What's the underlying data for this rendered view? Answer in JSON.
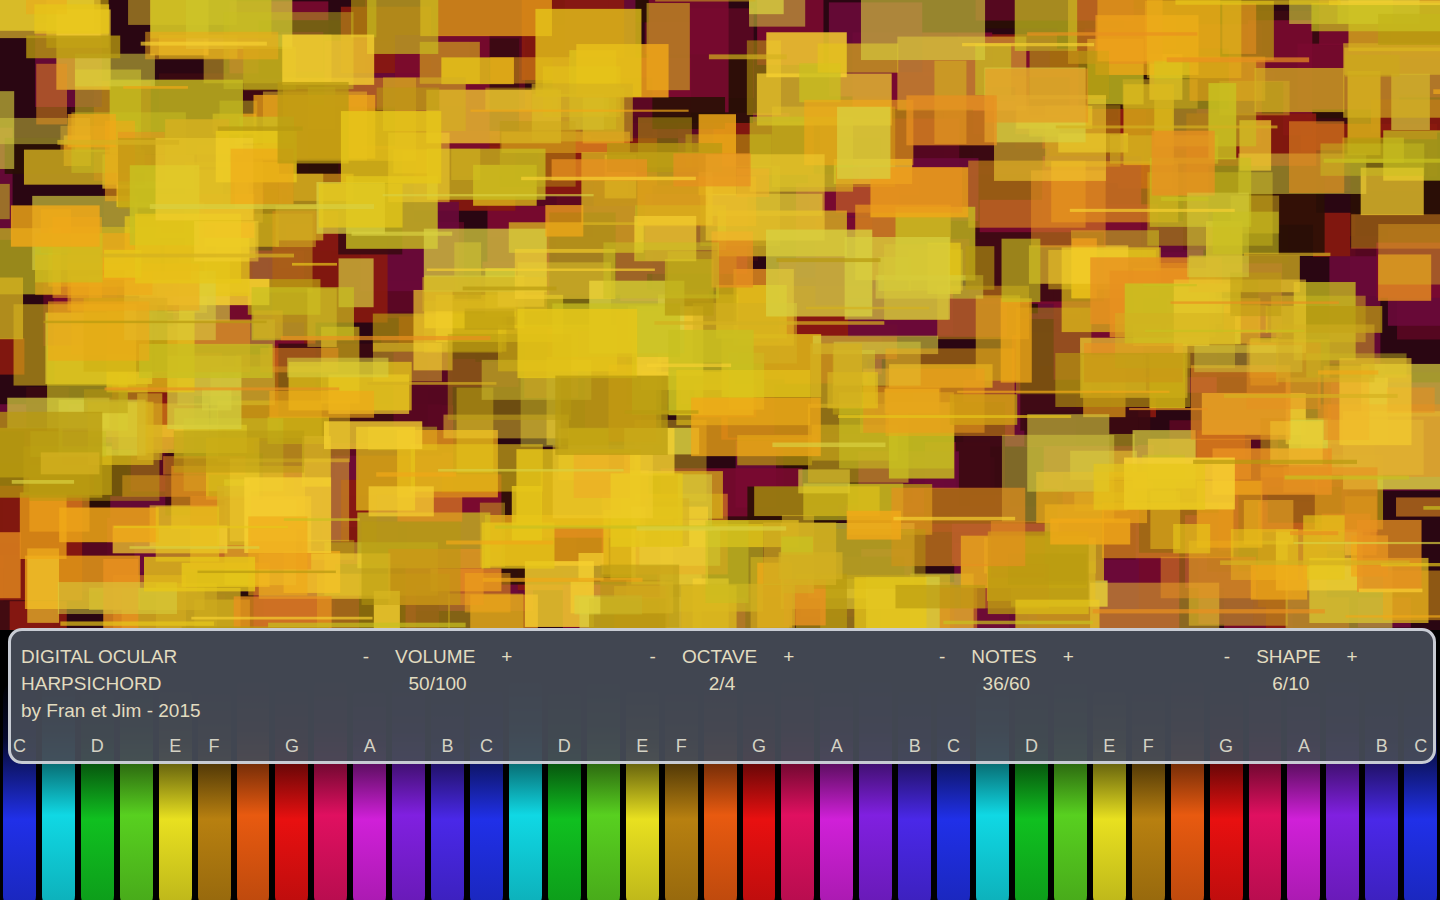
{
  "app": {
    "title_lines": [
      "DIGITAL OCULAR",
      "HARPSICHORD"
    ],
    "credit": "by Fran et Jim - 2015"
  },
  "controls": [
    {
      "label": "VOLUME",
      "value": "50/100",
      "minus": "-",
      "plus": "+"
    },
    {
      "label": "OCTAVE",
      "value": "2/4",
      "minus": "-",
      "plus": "+"
    },
    {
      "label": "NOTES",
      "value": "36/60",
      "minus": "-",
      "plus": "+"
    },
    {
      "label": "SHAPE",
      "value": "6/10",
      "minus": "-",
      "plus": "+"
    }
  ],
  "keys": [
    {
      "kind": "natural",
      "label": "C",
      "color": "#2030e8"
    },
    {
      "kind": "sharp",
      "color": "#10d8e4"
    },
    {
      "kind": "natural",
      "label": "D",
      "color": "#10c020"
    },
    {
      "kind": "sharp",
      "color": "#58d020"
    },
    {
      "kind": "natural",
      "label": "E",
      "color": "#e8e020"
    },
    {
      "kind": "natural",
      "label": "F",
      "color": "#b88010"
    },
    {
      "kind": "sharp",
      "color": "#e85a10"
    },
    {
      "kind": "natural",
      "label": "G",
      "color": "#e81010"
    },
    {
      "kind": "sharp",
      "color": "#e01060"
    },
    {
      "kind": "natural",
      "label": "A",
      "color": "#d020d8"
    },
    {
      "kind": "sharp",
      "color": "#8020e0"
    },
    {
      "kind": "natural",
      "label": "B",
      "color": "#4a28e8"
    },
    {
      "kind": "natural",
      "label": "C",
      "color": "#2030e8"
    },
    {
      "kind": "sharp",
      "color": "#10d8e4"
    },
    {
      "kind": "natural",
      "label": "D",
      "color": "#10c020"
    },
    {
      "kind": "sharp",
      "color": "#58d020"
    },
    {
      "kind": "natural",
      "label": "E",
      "color": "#e8e020"
    },
    {
      "kind": "natural",
      "label": "F",
      "color": "#b88010"
    },
    {
      "kind": "sharp",
      "color": "#e85a10"
    },
    {
      "kind": "natural",
      "label": "G",
      "color": "#e81010"
    },
    {
      "kind": "sharp",
      "color": "#e01060"
    },
    {
      "kind": "natural",
      "label": "A",
      "color": "#d020d8"
    },
    {
      "kind": "sharp",
      "color": "#8020e0"
    },
    {
      "kind": "natural",
      "label": "B",
      "color": "#4a28e8"
    },
    {
      "kind": "natural",
      "label": "C",
      "color": "#2030e8"
    },
    {
      "kind": "sharp",
      "color": "#10d8e4"
    },
    {
      "kind": "natural",
      "label": "D",
      "color": "#10c020"
    },
    {
      "kind": "sharp",
      "color": "#58d020"
    },
    {
      "kind": "natural",
      "label": "E",
      "color": "#e8e020"
    },
    {
      "kind": "natural",
      "label": "F",
      "color": "#b88010"
    },
    {
      "kind": "sharp",
      "color": "#e85a10"
    },
    {
      "kind": "natural",
      "label": "G",
      "color": "#e81010"
    },
    {
      "kind": "sharp",
      "color": "#e01060"
    },
    {
      "kind": "natural",
      "label": "A",
      "color": "#d020d8"
    },
    {
      "kind": "sharp",
      "color": "#8020e0"
    },
    {
      "kind": "natural",
      "label": "B",
      "color": "#4a28e8"
    },
    {
      "kind": "natural",
      "label": "C",
      "color": "#2030e8"
    }
  ]
}
